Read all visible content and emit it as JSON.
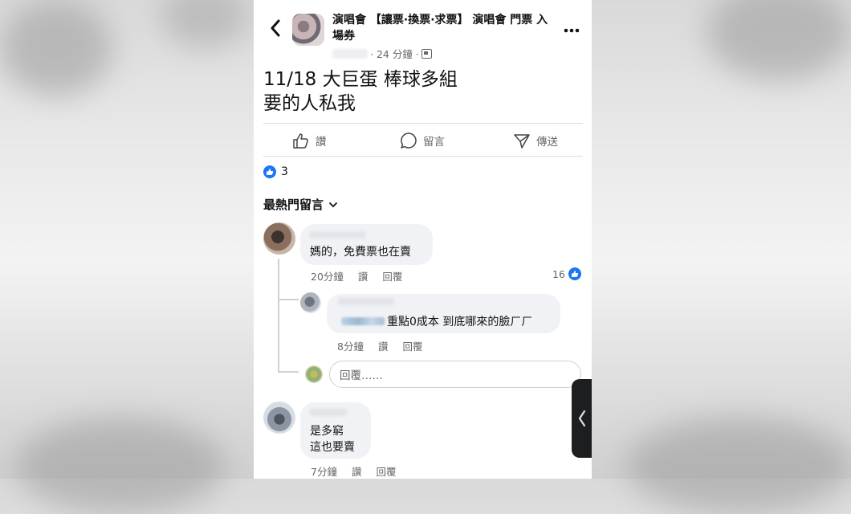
{
  "post": {
    "group_title": "演唱會 【讓票·換票·求票】 演唱會 門票 入場券",
    "time": "· 24 分鐘 ·",
    "text_line1": "11/18 大巨蛋 棒球多組",
    "text_line2": "要的人私我"
  },
  "actions": {
    "like": "讚",
    "comment": "留言",
    "share": "傳送"
  },
  "reactions": {
    "count": "3"
  },
  "comments_header": {
    "sort_label": "最熱門留言"
  },
  "comments": [
    {
      "text": "媽的，免費票也在賣",
      "time": "20分鐘",
      "like": "讚",
      "reply": "回覆",
      "reactions": "16"
    },
    {
      "text": "重點0成本 到底哪來的臉ㄏㄏ",
      "time": "8分鐘",
      "like": "讚",
      "reply": "回覆"
    },
    {
      "text_line1": "是多窮",
      "text_line2": "這也要賣",
      "time": "7分鐘",
      "like": "讚",
      "reply": "回覆"
    }
  ],
  "reply_box": {
    "placeholder": "回覆……"
  },
  "icons": [
    "back-arrow-icon",
    "more-icon",
    "thumbs-up-icon",
    "comment-bubble-icon",
    "send-icon",
    "chevron-down-icon",
    "like-badge-icon",
    "globe-icon",
    "side-tab-chevron-icon"
  ],
  "colors": {
    "accent": "#1877f2",
    "bubble": "#f0f2f5",
    "muted_text": "#65676b"
  }
}
